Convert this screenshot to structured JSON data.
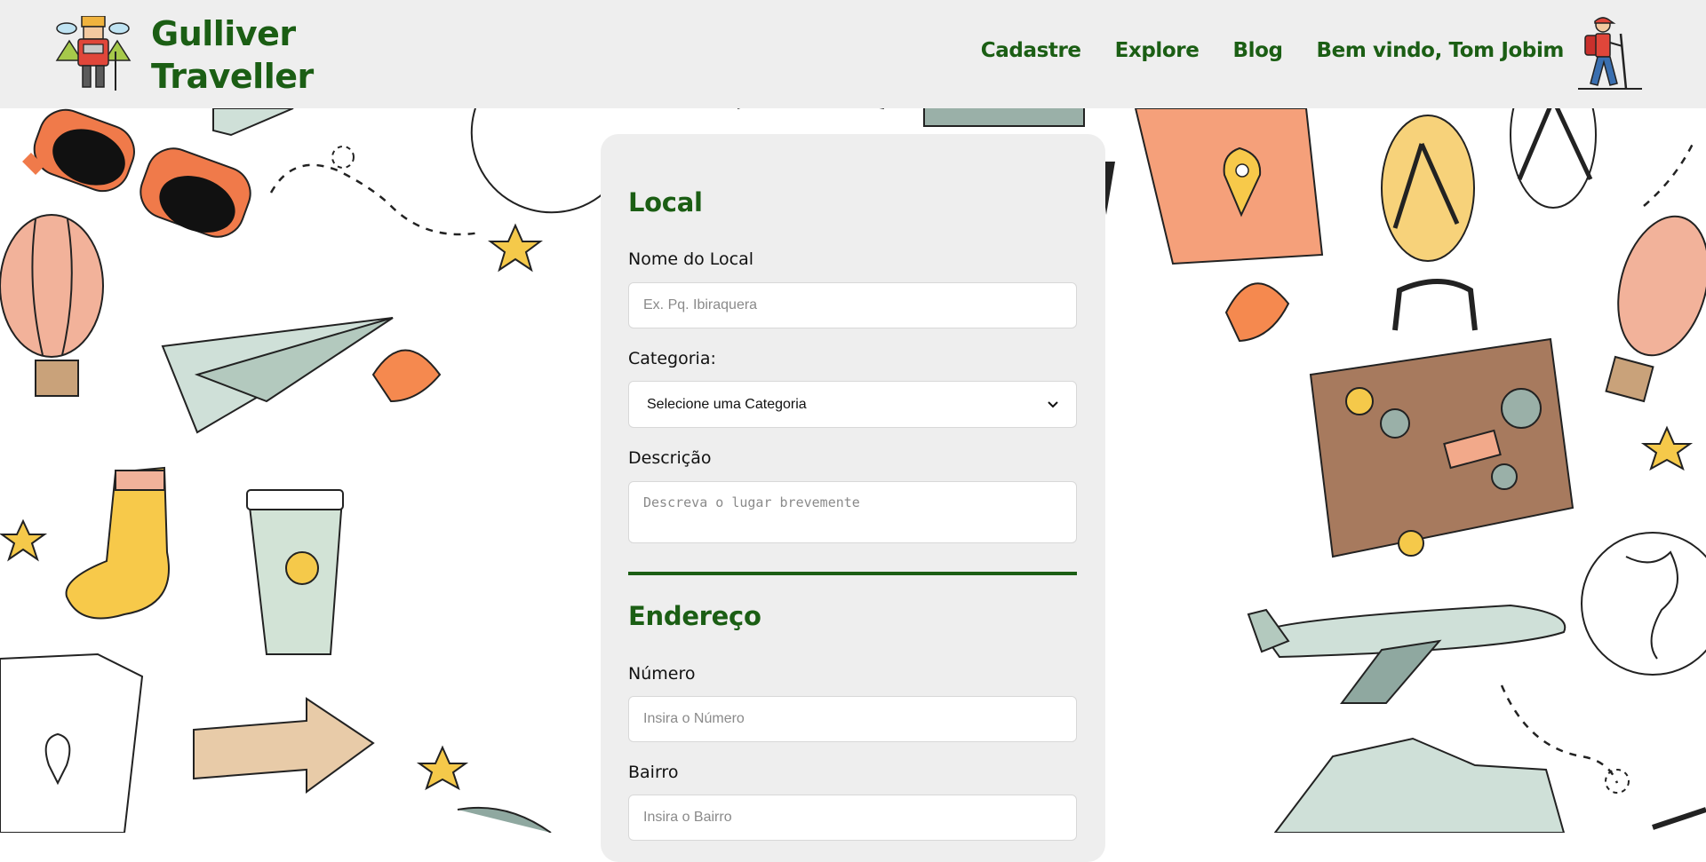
{
  "header": {
    "brand_line1": "Gulliver",
    "brand_line2": "Traveller",
    "nav": [
      {
        "label": "Cadastre"
      },
      {
        "label": "Explore"
      },
      {
        "label": "Blog"
      },
      {
        "label": "Bem vindo, Tom Jobim"
      }
    ]
  },
  "form": {
    "local_title": "Local",
    "nome_label": "Nome do Local",
    "nome_placeholder": "Ex. Pq. Ibiraquera",
    "nome_value": "",
    "categoria_label": "Categoria:",
    "categoria_selected": "Selecione uma Categoria",
    "descricao_label": "Descrição",
    "descricao_placeholder": "Descreva o lugar brevemente",
    "endereco_title": "Endereço",
    "numero_label": "Número",
    "numero_placeholder": "Insira o Número",
    "bairro_label": "Bairro",
    "bairro_placeholder": "Insira o Bairro"
  },
  "colors": {
    "accent_green": "#1b5e14",
    "header_bg": "#eeeeee",
    "card_bg": "#eeeeee"
  },
  "icons": {
    "logo": "traveller-backpack-icon",
    "user": "hiker-icon",
    "select_arrow": "chevron-down-icon"
  }
}
